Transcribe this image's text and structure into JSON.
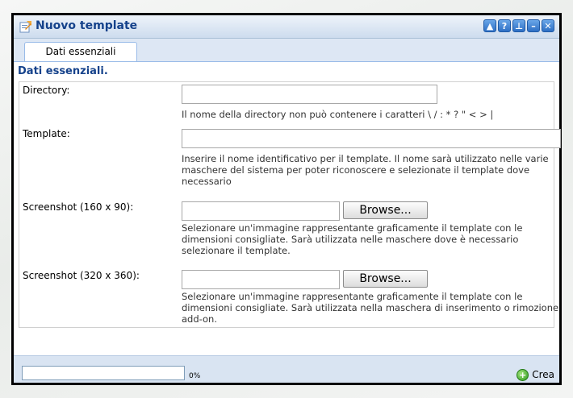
{
  "window": {
    "title": "Nuovo template",
    "tools": [
      {
        "icon": "collapse-icon",
        "glyph": "▲"
      },
      {
        "icon": "help-icon",
        "glyph": "?"
      },
      {
        "icon": "pin-icon",
        "glyph": "⊥"
      },
      {
        "icon": "minimize-icon",
        "glyph": "–"
      },
      {
        "icon": "close-icon",
        "glyph": "✕"
      }
    ]
  },
  "tabs": [
    {
      "label": "Dati essenziali",
      "active": true
    }
  ],
  "section": {
    "title": "Dati essenziali."
  },
  "form": {
    "directory": {
      "label": "Directory:",
      "value": "",
      "hint": "Il nome della directory non può contenere i caratteri \\ / : * ? \" < > |"
    },
    "template": {
      "label": "Template:",
      "value": "",
      "hint": "Inserire il nome identificativo per il template. Il nome sarà utilizzato nelle varie maschere del sistema per poter riconoscere e selezionate il template dove necessario"
    },
    "screenshot_small": {
      "label": "Screenshot (160 x 90):",
      "value": "",
      "button": "Browse...",
      "hint": "Selezionare un'immagine rappresentante graficamente il template con le dimensioni consigliate. Sarà utilizzata nelle maschere dove è necessario selezionare il template."
    },
    "screenshot_large": {
      "label": "Screenshot (320 x 360):",
      "value": "",
      "button": "Browse...",
      "hint": "Selezionare un'immagine rappresentante graficamente il template con le dimensioni consigliate. Sarà utilizzata nella maschera di inserimento o rimozione add-on."
    }
  },
  "status": {
    "progress_percent": 0,
    "progress_text": "0%",
    "create_label": "Crea"
  },
  "colors": {
    "title": "#15428b",
    "accent": "#99bbe8"
  }
}
